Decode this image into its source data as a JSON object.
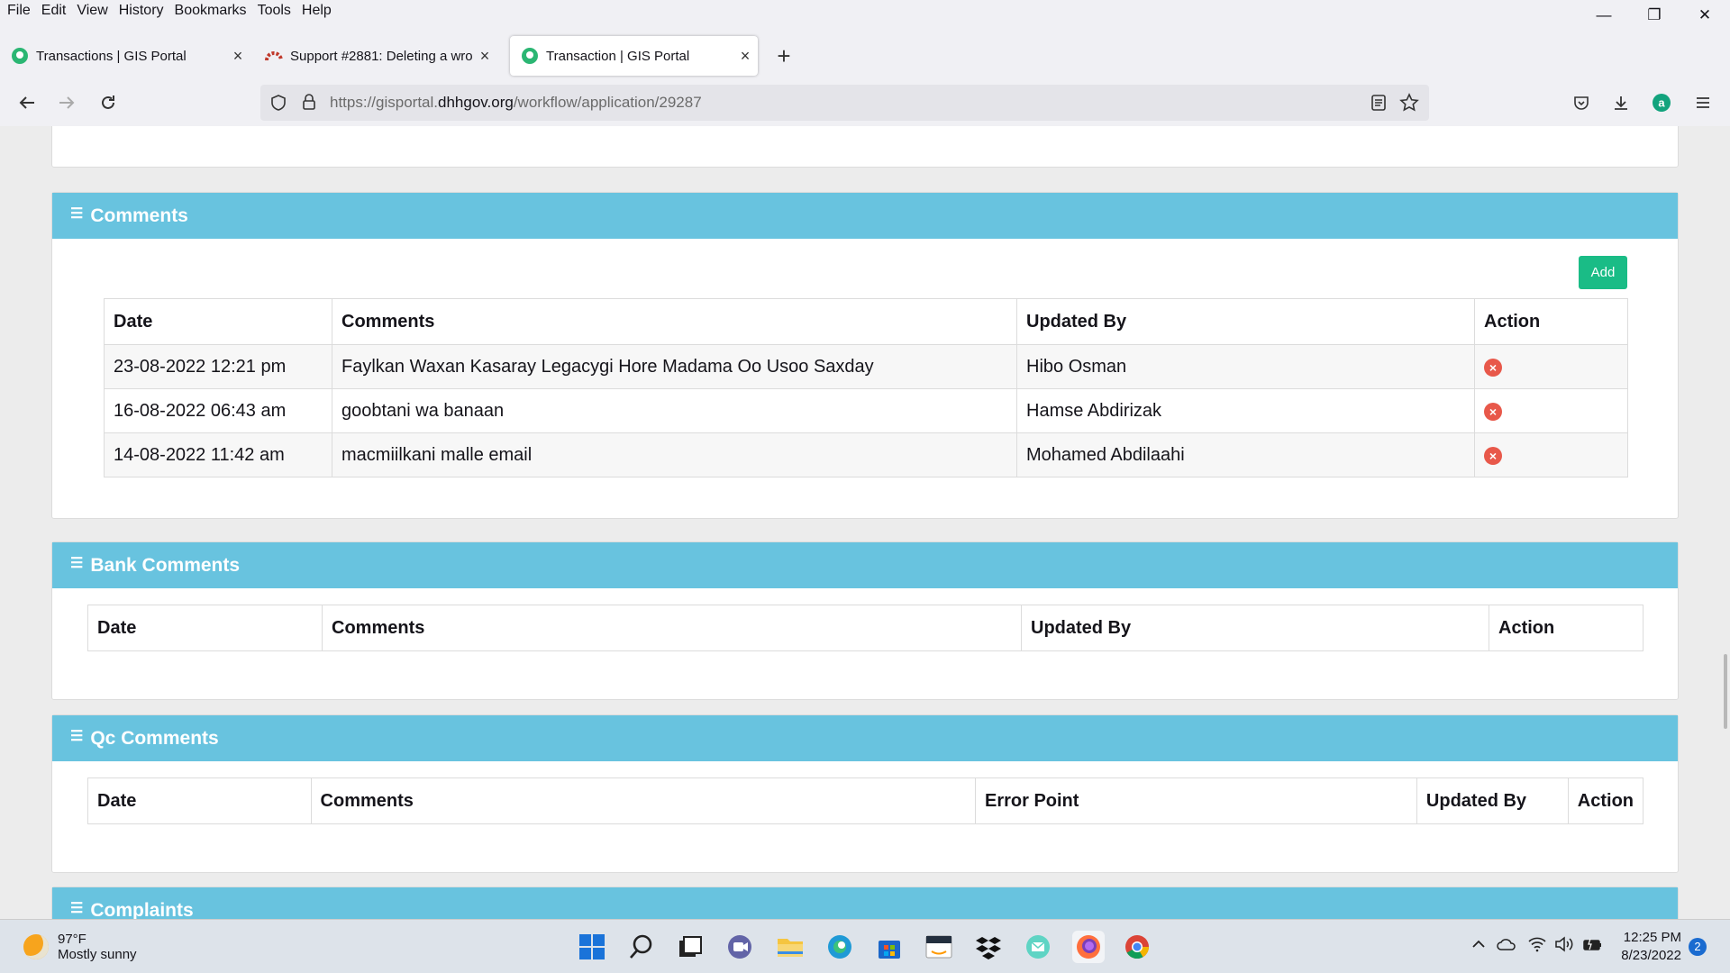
{
  "menu": [
    "File",
    "Edit",
    "View",
    "History",
    "Bookmarks",
    "Tools",
    "Help"
  ],
  "window_controls": {
    "minimize": "—",
    "restore": "❐",
    "close": "✕"
  },
  "tabs": [
    {
      "title": "Transactions | GIS Portal",
      "close": "×"
    },
    {
      "title": "Support #2881: Deleting a wron",
      "close": "×"
    },
    {
      "title": "Transaction | GIS Portal",
      "close": "×"
    }
  ],
  "new_tab": "+",
  "url": {
    "prefix": "https://gisportal.",
    "host": "dhhgov.org",
    "path": "/workflow/application/29287"
  },
  "comments": {
    "title": "Comments",
    "add_label": "Add",
    "headers": [
      "Date",
      "Comments",
      "Updated By",
      "Action"
    ],
    "rows": [
      {
        "date": "23-08-2022 12:21 pm",
        "comment": "Faylkan Waxan Kasaray Legacygi Hore Madama Oo Usoo Saxday",
        "by": "Hibo Osman"
      },
      {
        "date": "16-08-2022 06:43 am",
        "comment": "goobtani wa banaan",
        "by": "Hamse Abdirizak"
      },
      {
        "date": "14-08-2022 11:42 am",
        "comment": "macmiilkani malle email",
        "by": "Mohamed Abdilaahi"
      }
    ]
  },
  "bank_comments": {
    "title": "Bank Comments",
    "headers": [
      "Date",
      "Comments",
      "Updated By",
      "Action"
    ]
  },
  "qc_comments": {
    "title": "Qc Comments",
    "headers": [
      "Date",
      "Comments",
      "Error Point",
      "Updated By",
      "Action"
    ]
  },
  "complaints": {
    "title": "Complaints"
  },
  "taskbar": {
    "weather_temp": "97°F",
    "weather_desc": "Mostly sunny",
    "time": "12:25 PM",
    "date": "8/23/2022",
    "notifications": "2"
  },
  "colors": {
    "panel_header": "#68c3df",
    "add_button": "#1abc86",
    "delete_icon": "#e8584a"
  }
}
